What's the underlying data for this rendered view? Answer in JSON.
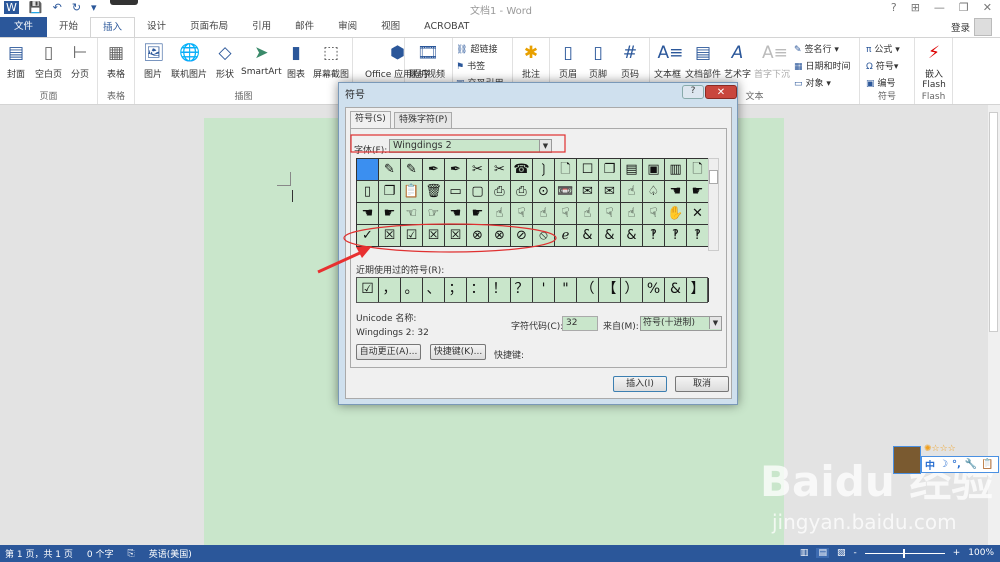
{
  "titlebar": {
    "title": "文档1 - Word",
    "qat": [
      "W",
      "💾",
      "↶",
      "↻",
      "▾"
    ],
    "controls": [
      "?",
      "⊞",
      "—",
      "❐",
      "✕"
    ],
    "login": "登录"
  },
  "tabs": [
    "文件",
    "开始",
    "插入",
    "设计",
    "页面布局",
    "引用",
    "邮件",
    "审阅",
    "视图",
    "ACROBAT"
  ],
  "ribbon": {
    "pages": {
      "label": "页面",
      "items": [
        "封面",
        "空白页",
        "分页"
      ]
    },
    "tables": {
      "label": "表格",
      "items": [
        "表格"
      ]
    },
    "illustrations": {
      "label": "插图",
      "items": [
        "图片",
        "联机图片",
        "形状",
        "SmartArt",
        "图表",
        "屏幕截图"
      ]
    },
    "apps": {
      "items": [
        "Office 应用程序"
      ]
    },
    "media": {
      "items": [
        "联机视频"
      ]
    },
    "links": {
      "items": [
        "超链接",
        "书签",
        "交叉引用"
      ]
    },
    "comments": {
      "items": [
        "批注"
      ]
    },
    "headerfooter": {
      "items": [
        "页眉",
        "页脚",
        "页码"
      ]
    },
    "text": {
      "label": "文本",
      "items": [
        "文本框",
        "文档部件",
        "艺术字",
        "首字下沉"
      ],
      "small": [
        "签名行",
        "日期和时间",
        "对象"
      ]
    },
    "symbols": {
      "label": "符号",
      "items": [
        "公式",
        "符号",
        "编号"
      ]
    },
    "flash": {
      "label": "Flash",
      "items": [
        "嵌入 Flash"
      ]
    }
  },
  "dialog": {
    "title": "符号",
    "help": "?",
    "close": "✕",
    "tabs": [
      "符号(S)",
      "特殊字符(P)"
    ],
    "font_label": "字体(F):",
    "font_value": "Wingdings 2",
    "grid": [
      "",
      "✎",
      "✎",
      "✒",
      "✒",
      "✂",
      "✂",
      "☎",
      "❳",
      "🗋",
      "☐",
      "❐",
      "▤",
      "▣",
      "▥",
      "🗋",
      "▯",
      "❐",
      "📋",
      "🗑",
      "▭",
      "▢",
      "⎙",
      "⎙",
      "⊙",
      "📼",
      "✉",
      "✉",
      "☝",
      "♤",
      "☚",
      "☛",
      "☚",
      "☛",
      "☜",
      "☞",
      "☚",
      "☛",
      "☝",
      "☟",
      "☝",
      "☟",
      "☝",
      "☟",
      "☝",
      "☟",
      "✋",
      "✕",
      "✓",
      "☒",
      "☑",
      "☒",
      "☒",
      "⊗",
      "⊗",
      "⊘",
      "⦸",
      "ℯ",
      "&",
      "&",
      "&",
      "‽",
      "‽",
      "‽"
    ],
    "recent_label": "近期使用过的符号(R):",
    "recent": [
      "☑",
      "，",
      "。",
      "、",
      "；",
      "：",
      "！",
      "？",
      "'",
      "\"",
      "（",
      "【",
      "）",
      "%",
      "&",
      "】"
    ],
    "unicode_name_label": "Unicode 名称:",
    "unicode_code": "Wingdings 2: 32",
    "charcode_label": "字符代码(C):",
    "charcode_value": "32",
    "from_label": "来自(M):",
    "from_value": "符号(十进制)",
    "autocorrect": "自动更正(A)...",
    "shortcut_key_btn": "快捷键(K)...",
    "shortcut_label": "快捷键:",
    "insert": "插入(I)",
    "cancel": "取消"
  },
  "status": {
    "page": "第 1 页，共 1 页",
    "words": "0 个字",
    "lang": "英语(美国)",
    "zoom": "100%",
    "zoom_minus": "-",
    "zoom_plus": "+"
  },
  "ime": {
    "items": [
      "中",
      "☽",
      "°,",
      "🔧",
      "📋"
    ]
  },
  "watermark": {
    "text": "Baidu 经验",
    "url": "jingyan.baidu.com"
  }
}
